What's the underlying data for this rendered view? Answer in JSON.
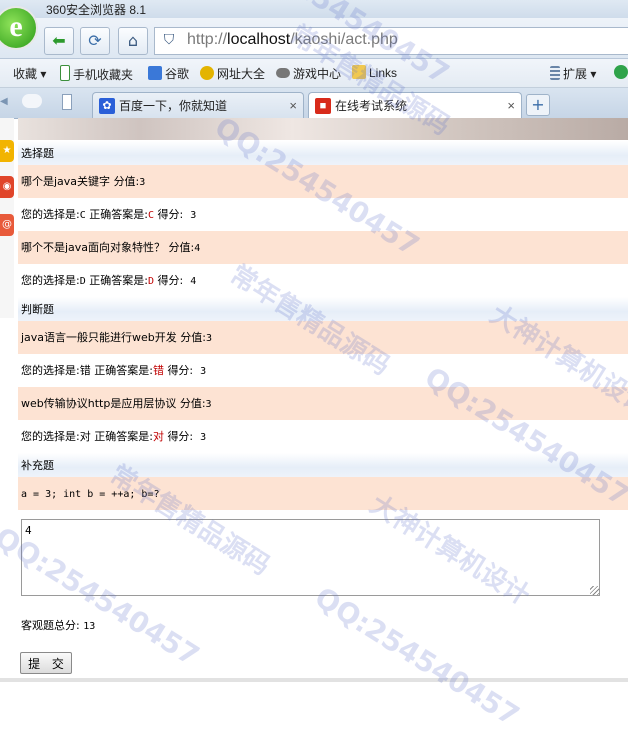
{
  "browser": {
    "title": "360安全浏览器 8.1",
    "url_prefix": "http://",
    "url_host": "localhost",
    "url_path": "/kaoshi/act.php",
    "bookmarks": [
      "收藏",
      "手机收藏夹",
      "谷歌",
      "网址大全",
      "游戏中心",
      "Links"
    ],
    "extension_label": "扩展",
    "tabs": [
      {
        "label": "百度一下，你就知道",
        "close": "×"
      },
      {
        "label": "在线考试系统",
        "close": "×"
      }
    ],
    "new_tab": "+"
  },
  "exam": {
    "section_choice": "选择题",
    "q1": {
      "text": "哪个是java关键字",
      "score_label": "分值:",
      "score": "3"
    },
    "a1": {
      "your_label": "您的选择是:",
      "your": "C",
      "correct_label": "正确答案是:",
      "correct": "C",
      "got_label": "得分:",
      "got": "3"
    },
    "q2": {
      "text": "哪个不是java面向对象特性？",
      "score_label": "分值:",
      "score": "4"
    },
    "a2": {
      "your_label": "您的选择是:",
      "your": "D",
      "correct_label": "正确答案是:",
      "correct": "D",
      "got_label": "得分:",
      "got": "4"
    },
    "section_judge": "判断题",
    "q3": {
      "text": "java语言一般只能进行web开发",
      "score_label": "分值:",
      "score": "3"
    },
    "a3": {
      "your_label": "您的选择是:",
      "your": "错",
      "correct_label": "正确答案是:",
      "correct": "错",
      "got_label": "得分:",
      "got": "3"
    },
    "q4": {
      "text": "web传输协议http是应用层协议",
      "score_label": "分值:",
      "score": "3"
    },
    "a4": {
      "your_label": "您的选择是:",
      "your": "对",
      "correct_label": "正确答案是:",
      "correct": "对",
      "got_label": "得分:",
      "got": "3"
    },
    "section_fill": "补充题",
    "q5": {
      "text": "a = 3; int b = ++a; b=?"
    },
    "answer_value": "4",
    "objective_total_label": "客观题总分:",
    "objective_total": "13",
    "submit_label": "提 交"
  },
  "watermarks": {
    "qq": "QQ:254540457",
    "site": "大神计算机设计",
    "brand": "常年售精品源码"
  },
  "colors": {
    "question_bg": "#fde3d3",
    "section_bg": "#e6eef8",
    "highlight": "#c00000"
  }
}
